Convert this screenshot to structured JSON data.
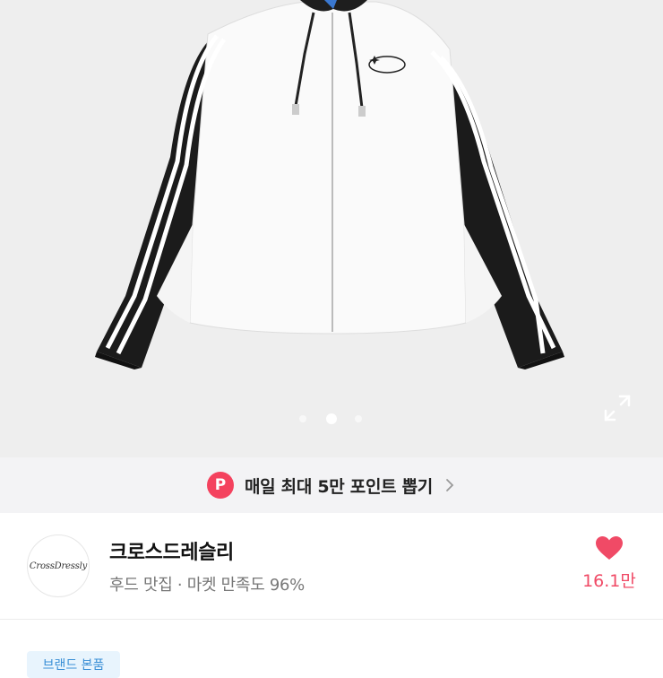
{
  "gallery": {
    "slide_count": 3,
    "active_index": 1,
    "expand_icon": "expand-icon"
  },
  "promo": {
    "badge": "P",
    "text": "매일 최대 5만 포인트 뽑기",
    "chevron_icon": "chevron-right-icon"
  },
  "shop": {
    "logo_text": "CrossDressly",
    "name": "크로스드레슬리",
    "desc": "후드 맛집 · 마켓 만족도 96%",
    "like_icon": "heart-icon",
    "like_count": "16.1만"
  },
  "tag": {
    "label": "브랜드 본품"
  },
  "colors": {
    "accent": "#f04a66",
    "badge": "#f4425e",
    "tag_text": "#3a8fd6",
    "tag_bg": "#e8f4fd"
  }
}
